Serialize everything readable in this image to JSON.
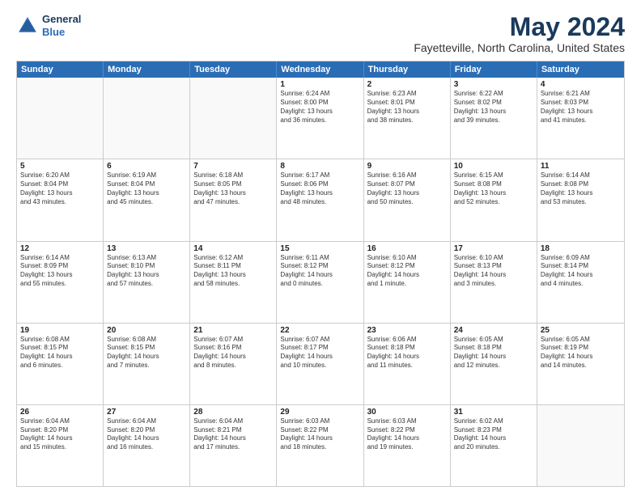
{
  "header": {
    "logo_line1": "General",
    "logo_line2": "Blue",
    "month": "May 2024",
    "location": "Fayetteville, North Carolina, United States"
  },
  "day_headers": [
    "Sunday",
    "Monday",
    "Tuesday",
    "Wednesday",
    "Thursday",
    "Friday",
    "Saturday"
  ],
  "weeks": [
    [
      {
        "num": "",
        "info": "",
        "empty": true
      },
      {
        "num": "",
        "info": "",
        "empty": true
      },
      {
        "num": "",
        "info": "",
        "empty": true
      },
      {
        "num": "1",
        "info": "Sunrise: 6:24 AM\nSunset: 8:00 PM\nDaylight: 13 hours\nand 36 minutes."
      },
      {
        "num": "2",
        "info": "Sunrise: 6:23 AM\nSunset: 8:01 PM\nDaylight: 13 hours\nand 38 minutes."
      },
      {
        "num": "3",
        "info": "Sunrise: 6:22 AM\nSunset: 8:02 PM\nDaylight: 13 hours\nand 39 minutes."
      },
      {
        "num": "4",
        "info": "Sunrise: 6:21 AM\nSunset: 8:03 PM\nDaylight: 13 hours\nand 41 minutes."
      }
    ],
    [
      {
        "num": "5",
        "info": "Sunrise: 6:20 AM\nSunset: 8:04 PM\nDaylight: 13 hours\nand 43 minutes."
      },
      {
        "num": "6",
        "info": "Sunrise: 6:19 AM\nSunset: 8:04 PM\nDaylight: 13 hours\nand 45 minutes."
      },
      {
        "num": "7",
        "info": "Sunrise: 6:18 AM\nSunset: 8:05 PM\nDaylight: 13 hours\nand 47 minutes."
      },
      {
        "num": "8",
        "info": "Sunrise: 6:17 AM\nSunset: 8:06 PM\nDaylight: 13 hours\nand 48 minutes."
      },
      {
        "num": "9",
        "info": "Sunrise: 6:16 AM\nSunset: 8:07 PM\nDaylight: 13 hours\nand 50 minutes."
      },
      {
        "num": "10",
        "info": "Sunrise: 6:15 AM\nSunset: 8:08 PM\nDaylight: 13 hours\nand 52 minutes."
      },
      {
        "num": "11",
        "info": "Sunrise: 6:14 AM\nSunset: 8:08 PM\nDaylight: 13 hours\nand 53 minutes."
      }
    ],
    [
      {
        "num": "12",
        "info": "Sunrise: 6:14 AM\nSunset: 8:09 PM\nDaylight: 13 hours\nand 55 minutes."
      },
      {
        "num": "13",
        "info": "Sunrise: 6:13 AM\nSunset: 8:10 PM\nDaylight: 13 hours\nand 57 minutes."
      },
      {
        "num": "14",
        "info": "Sunrise: 6:12 AM\nSunset: 8:11 PM\nDaylight: 13 hours\nand 58 minutes."
      },
      {
        "num": "15",
        "info": "Sunrise: 6:11 AM\nSunset: 8:12 PM\nDaylight: 14 hours\nand 0 minutes."
      },
      {
        "num": "16",
        "info": "Sunrise: 6:10 AM\nSunset: 8:12 PM\nDaylight: 14 hours\nand 1 minute."
      },
      {
        "num": "17",
        "info": "Sunrise: 6:10 AM\nSunset: 8:13 PM\nDaylight: 14 hours\nand 3 minutes."
      },
      {
        "num": "18",
        "info": "Sunrise: 6:09 AM\nSunset: 8:14 PM\nDaylight: 14 hours\nand 4 minutes."
      }
    ],
    [
      {
        "num": "19",
        "info": "Sunrise: 6:08 AM\nSunset: 8:15 PM\nDaylight: 14 hours\nand 6 minutes."
      },
      {
        "num": "20",
        "info": "Sunrise: 6:08 AM\nSunset: 8:15 PM\nDaylight: 14 hours\nand 7 minutes."
      },
      {
        "num": "21",
        "info": "Sunrise: 6:07 AM\nSunset: 8:16 PM\nDaylight: 14 hours\nand 8 minutes."
      },
      {
        "num": "22",
        "info": "Sunrise: 6:07 AM\nSunset: 8:17 PM\nDaylight: 14 hours\nand 10 minutes."
      },
      {
        "num": "23",
        "info": "Sunrise: 6:06 AM\nSunset: 8:18 PM\nDaylight: 14 hours\nand 11 minutes."
      },
      {
        "num": "24",
        "info": "Sunrise: 6:05 AM\nSunset: 8:18 PM\nDaylight: 14 hours\nand 12 minutes."
      },
      {
        "num": "25",
        "info": "Sunrise: 6:05 AM\nSunset: 8:19 PM\nDaylight: 14 hours\nand 14 minutes."
      }
    ],
    [
      {
        "num": "26",
        "info": "Sunrise: 6:04 AM\nSunset: 8:20 PM\nDaylight: 14 hours\nand 15 minutes."
      },
      {
        "num": "27",
        "info": "Sunrise: 6:04 AM\nSunset: 8:20 PM\nDaylight: 14 hours\nand 16 minutes."
      },
      {
        "num": "28",
        "info": "Sunrise: 6:04 AM\nSunset: 8:21 PM\nDaylight: 14 hours\nand 17 minutes."
      },
      {
        "num": "29",
        "info": "Sunrise: 6:03 AM\nSunset: 8:22 PM\nDaylight: 14 hours\nand 18 minutes."
      },
      {
        "num": "30",
        "info": "Sunrise: 6:03 AM\nSunset: 8:22 PM\nDaylight: 14 hours\nand 19 minutes."
      },
      {
        "num": "31",
        "info": "Sunrise: 6:02 AM\nSunset: 8:23 PM\nDaylight: 14 hours\nand 20 minutes."
      },
      {
        "num": "",
        "info": "",
        "empty": true
      }
    ]
  ]
}
